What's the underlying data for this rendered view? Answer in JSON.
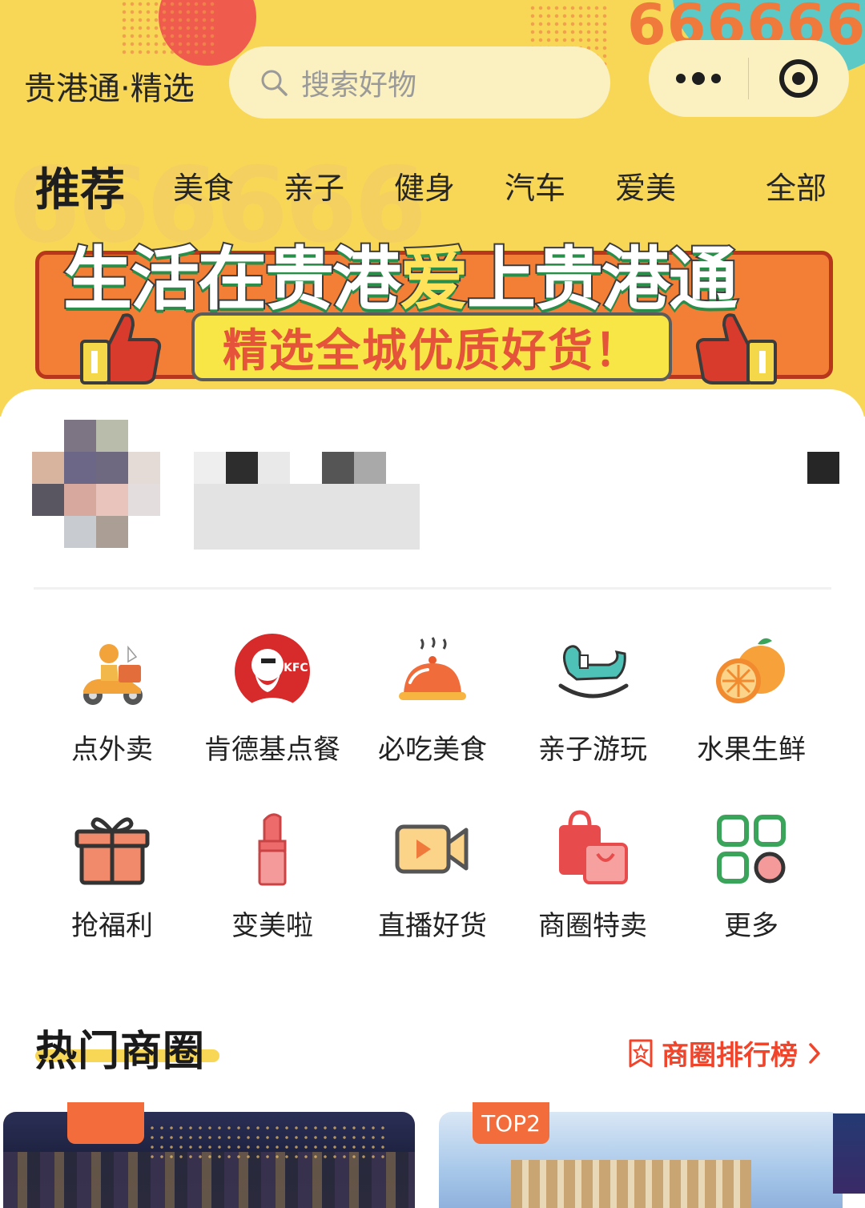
{
  "header": {
    "brand_number": "666666",
    "watermark": "666666",
    "app_title": "贵港通·精选",
    "search_placeholder": "搜索好物",
    "more_icon": "ellipsis-icon",
    "target_icon": "target-icon"
  },
  "tabs": [
    {
      "label": "推荐",
      "active": true
    },
    {
      "label": "美食",
      "active": false
    },
    {
      "label": "亲子",
      "active": false
    },
    {
      "label": "健身",
      "active": false
    },
    {
      "label": "汽车",
      "active": false
    },
    {
      "label": "爱美",
      "active": false
    },
    {
      "label": "全部",
      "active": false
    }
  ],
  "banner": {
    "title_part1": "生活在贵港",
    "title_heart": "爱",
    "title_part2": "上贵港通",
    "subtitle": "精选全城优质好货！"
  },
  "categories": [
    {
      "label": "点外卖",
      "icon": "delivery-scooter-icon"
    },
    {
      "label": "肯德基点餐",
      "icon": "kfc-logo-icon"
    },
    {
      "label": "必吃美食",
      "icon": "food-cloche-icon"
    },
    {
      "label": "亲子游玩",
      "icon": "rocking-horse-icon"
    },
    {
      "label": "水果生鲜",
      "icon": "orange-icon"
    },
    {
      "label": "抢福利",
      "icon": "gift-icon"
    },
    {
      "label": "变美啦",
      "icon": "lipstick-icon"
    },
    {
      "label": "直播好货",
      "icon": "video-camera-icon"
    },
    {
      "label": "商圈特卖",
      "icon": "shopping-bag-icon"
    },
    {
      "label": "更多",
      "icon": "grid-more-icon"
    }
  ],
  "section": {
    "title": "热门商圈",
    "rank_link": "商圈排行榜",
    "rank_icon": "ribbon-star-icon",
    "chevron_icon": "chevron-right-icon"
  },
  "cards": [
    {
      "badge": ""
    },
    {
      "badge": "TOP2"
    }
  ],
  "colors": {
    "header_bg": "#f8d757",
    "accent_red": "#f0442b",
    "badge_orange": "#f26d3b"
  }
}
